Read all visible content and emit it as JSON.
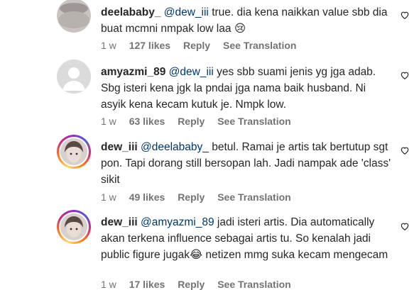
{
  "comments": [
    {
      "username": "deelababy_",
      "mention": "@dew_iii",
      "text": "true. dia kena naikkan value sbb dia buat mcmni nmpak low laa",
      "emoji": "😢",
      "time": "1 w",
      "likes": "127 likes",
      "reply": "Reply",
      "translate": "See Translation"
    },
    {
      "username": "amyazmi_89",
      "mention": "@dew_iii",
      "text": "yes sbb suami jenis yg jga adab. Sbg isteri kena jgk la pndai jga nama baik husband. Ni asyik kena kecam kutuk je. Nmpk low.",
      "time": "1 w",
      "likes": "63 likes",
      "reply": "Reply",
      "translate": "See Translation"
    },
    {
      "username": "dew_iii",
      "mention": "@deelababy_",
      "text": "betul. Ramai je artis tak bertutup sgt pon. Tapi dorang still bersopan lah. Jadi nampak ade 'class' sikit",
      "time": "1 w",
      "likes": "49 likes",
      "reply": "Reply",
      "translate": "See Translation"
    },
    {
      "username": "dew_iii",
      "mention": "@amyazmi_89",
      "text_part1": "jadi isteri artis. Dia automatically akan terkena influence sebagai artis tu. So kenalah jadi public figure jugak",
      "emoji": "😂",
      "text_part2": "netizen mmg suka kecam mengecam",
      "time": "1 w",
      "likes": "17 likes",
      "reply": "Reply",
      "translate": "See Translation"
    }
  ],
  "icons": {
    "like": "heart-outline-icon"
  }
}
